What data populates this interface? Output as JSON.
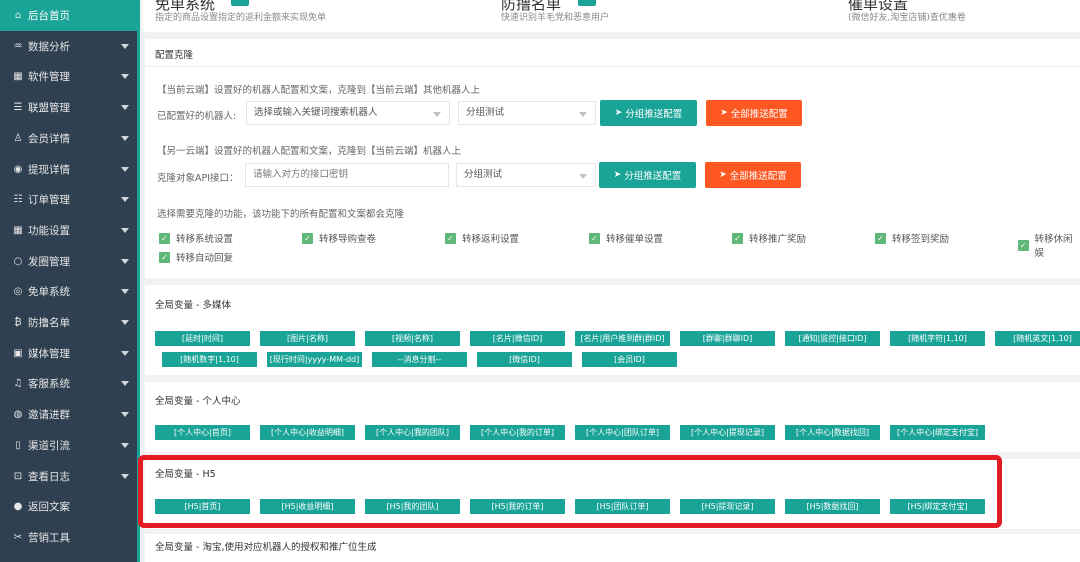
{
  "sidebar": {
    "items": [
      {
        "label": "后台首页",
        "icon": "home-icon",
        "glyph": "⌂",
        "active": true,
        "arrow": false
      },
      {
        "label": "数据分析",
        "icon": "chart-icon",
        "glyph": "♒",
        "arrow": true
      },
      {
        "label": "软件管理",
        "icon": "software-icon",
        "glyph": "▦",
        "arrow": true
      },
      {
        "label": "联盟管理",
        "icon": "list-icon",
        "glyph": "☰",
        "arrow": true
      },
      {
        "label": "会员详情",
        "icon": "user-icon",
        "glyph": "♙",
        "arrow": true
      },
      {
        "label": "提现详情",
        "icon": "withdraw-icon",
        "glyph": "◉",
        "arrow": true
      },
      {
        "label": "订单管理",
        "icon": "order-icon",
        "glyph": "☷",
        "arrow": true
      },
      {
        "label": "功能设置",
        "icon": "settings-icon",
        "glyph": "▦",
        "arrow": true
      },
      {
        "label": "发圈管理",
        "icon": "circle-icon",
        "glyph": "○",
        "arrow": true
      },
      {
        "label": "免单系统",
        "icon": "free-icon",
        "glyph": "◎",
        "arrow": true
      },
      {
        "label": "防撸名单",
        "icon": "blacklist-icon",
        "glyph": "₿",
        "arrow": true
      },
      {
        "label": "媒体管理",
        "icon": "media-icon",
        "glyph": "▣",
        "arrow": true
      },
      {
        "label": "客服系统",
        "icon": "bell-icon",
        "glyph": "♫",
        "arrow": true
      },
      {
        "label": "邀请进群",
        "icon": "invite-icon",
        "glyph": "◍",
        "arrow": true
      },
      {
        "label": "渠道引流",
        "icon": "channel-icon",
        "glyph": "▯",
        "arrow": true
      },
      {
        "label": "查看日志",
        "icon": "log-icon",
        "glyph": "⊡",
        "arrow": true
      },
      {
        "label": "返回文案",
        "icon": "chat-icon",
        "glyph": "●",
        "arrow": false
      },
      {
        "label": "营销工具",
        "icon": "tools-icon",
        "glyph": "✂",
        "arrow": false
      }
    ]
  },
  "top_cards": [
    {
      "title": "免单系统",
      "subtitle": "指定的商品设置指定的返利金额来实现免单",
      "badge": "→"
    },
    {
      "title": "防撸名单",
      "subtitle": "快速识别羊毛党和恶意用户",
      "badge": "→"
    },
    {
      "title": "催单设置",
      "subtitle": "(微信好友,淘宝店铺)查优惠卷",
      "badge": ""
    }
  ],
  "clone": {
    "title": "配置克隆",
    "current_desc": "【当前云端】设置好的机器人配置和文案，克隆到【当前云端】其他机器人上",
    "robot_label": "已配置好的机器人:",
    "robot_placeholder": "选择或输入关键词搜索机器人",
    "group_value_1": "分组测试",
    "push_group_label": "分组推送配置",
    "push_all_label": "全部推送配置",
    "other_desc": "【另一云端】设置好的机器人配置和文案，克隆到【当前云端】机器人上",
    "api_label": "克隆对象API接口：",
    "api_placeholder": "请输入对方的接口密钥",
    "group_value_2": "分组测试",
    "features_desc": "选择需要克隆的功能，该功能下的所有配置和文案都会克隆",
    "checkboxes": [
      "转移系统设置",
      "转移导购查卷",
      "转移返利设置",
      "转移催单设置",
      "转移推广奖励",
      "转移签到奖励",
      "转移休闲娱",
      "转移自动回复"
    ]
  },
  "multimedia": {
    "title": "全局变量 - 多媒体",
    "tags": [
      "[延时|时间]",
      "[图片|名称]",
      "[视频|名称]",
      "[名片|微信ID]",
      "[名片|用户推到群|群ID]",
      "[群聊|群聊ID]",
      "[通知|监控|接口ID]",
      "[随机字符|1,10]",
      "[随机英文|1,10]",
      "[随机数字|1,10]",
      "[现行时间|yyyy-MM-dd]",
      "--消息分割--",
      "[微信ID]",
      "[会员ID]"
    ]
  },
  "personal": {
    "title": "全局变量 - 个人中心",
    "tags": [
      "[个人中心|首页]",
      "[个人中心|收益明细]",
      "[个人中心|我的团队]",
      "[个人中心|我的订单]",
      "[个人中心|团队订单]",
      "[个人中心|提现记录]",
      "[个人中心|数据找回]",
      "[个人中心|绑定支付宝]"
    ]
  },
  "h5": {
    "title": "全局变量 - H5",
    "tags": [
      "[H5|首页]",
      "[H5|收益明细]",
      "[H5|我的团队]",
      "[H5|我的订单]",
      "[H5|团队订单]",
      "[H5|提现记录]",
      "[H5|数据找回]",
      "[H5|绑定支付宝]"
    ]
  },
  "taobao": {
    "title": "全局变量 - 淘宝,使用对应机器人的授权和推广位生成"
  },
  "colors": {
    "primary": "#1aa397",
    "orange": "#ff5722",
    "sidebar": "#2f4050",
    "highlight": "#e31b23"
  }
}
